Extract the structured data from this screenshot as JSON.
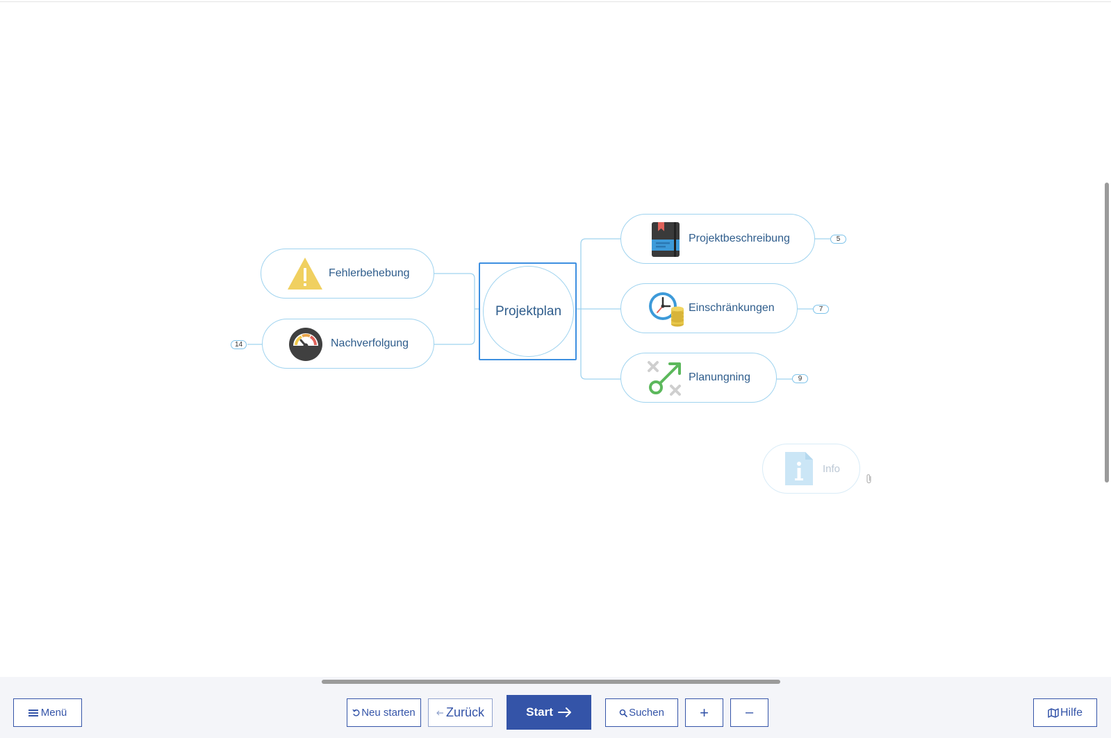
{
  "map": {
    "central": {
      "label": "Projektplan"
    },
    "topics": [
      {
        "id": "fehlerbehebung",
        "label": "Fehlerbehebung",
        "icon": "warning-icon",
        "badge": ""
      },
      {
        "id": "nachverfolgung",
        "label": "Nachverfolgung",
        "icon": "gauge-icon",
        "badge": "14"
      },
      {
        "id": "projektbeschreibung",
        "label": "Projektbeschreibung",
        "icon": "notebook-icon",
        "badge": "5"
      },
      {
        "id": "einschraenkungen",
        "label": "Einschränkungen",
        "icon": "clock-coins-icon",
        "badge": "7"
      },
      {
        "id": "planungning",
        "label": "Planungning",
        "icon": "strategy-icon",
        "badge": "9"
      }
    ],
    "floating": {
      "label": "Info",
      "icon": "info-document-icon",
      "attachment_icon": "paperclip-icon"
    }
  },
  "toolbar": {
    "menu_label": "Menü",
    "restart_label": "Neu starten",
    "back_label": "Zurück",
    "start_label": "Start",
    "search_label": "Suchen",
    "zoom_in_label": "+",
    "zoom_out_label": "–",
    "help_label": "Hilfe"
  },
  "colors": {
    "accent": "#3454a8",
    "node_border": "#9fd3ef",
    "node_text": "#2f5d8c",
    "selection": "#3d8fe0"
  }
}
